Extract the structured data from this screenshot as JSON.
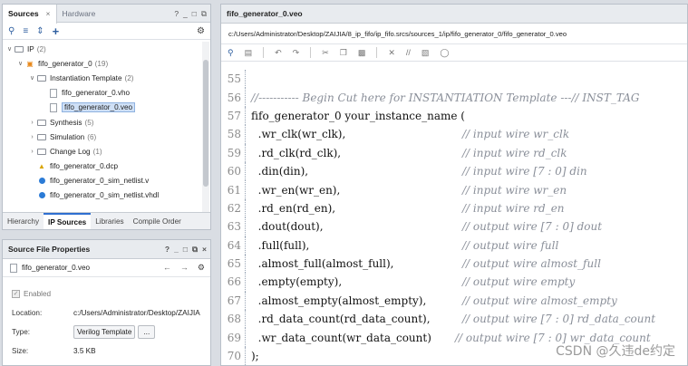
{
  "sources_panel": {
    "tabs": [
      "Sources",
      "Hardware"
    ],
    "tab_close": "×",
    "window_controls": [
      "?",
      "_",
      "□",
      "⧉"
    ],
    "toolbar_icons": [
      "search-icon",
      "collapse-all-icon",
      "expand-all-icon",
      "add-icon",
      "gear-icon"
    ],
    "tree": [
      {
        "label": "IP",
        "count": "(2)"
      },
      {
        "label": "fifo_generator_0",
        "count": "(19)"
      },
      {
        "label": "Instantiation Template",
        "count": "(2)"
      },
      {
        "label": "fifo_generator_0.vho",
        "count": ""
      },
      {
        "label": "fifo_generator_0.veo",
        "count": ""
      },
      {
        "label": "Synthesis",
        "count": "(5)"
      },
      {
        "label": "Simulation",
        "count": "(6)"
      },
      {
        "label": "Change Log",
        "count": "(1)"
      },
      {
        "label": "fifo_generator_0.dcp",
        "count": ""
      },
      {
        "label": "fifo_generator_0_sim_netlist.v",
        "count": ""
      },
      {
        "label": "fifo_generator_0_sim_netlist.vhdl",
        "count": ""
      }
    ],
    "bottom_tabs": [
      "Hierarchy",
      "IP Sources",
      "Libraries",
      "Compile Order"
    ]
  },
  "properties_panel": {
    "title": "Source File Properties",
    "window_controls": [
      "?",
      "_",
      "□",
      "⧉",
      "×"
    ],
    "file": "fifo_generator_0.veo",
    "enabled_label": "Enabled",
    "location_label": "Location:",
    "location_value": "c:/Users/Administrator/Desktop/ZAIJIA",
    "type_label": "Type:",
    "type_value": "Verilog Template",
    "type_button": "...",
    "size_label": "Size:",
    "size_value": "3.5 KB"
  },
  "editor": {
    "tab_title": "fifo_generator_0.veo",
    "path": "c:/Users/Administrator/Desktop/ZAIJIA/8_ip_fifo/ip_fifo.srcs/sources_1/ip/fifo_generator_0/fifo_generator_0.veo",
    "lines": [
      {
        "n": "55",
        "code": "",
        "comment": ""
      },
      {
        "n": "56",
        "code": "",
        "comment": "//----------- Begin Cut here for INSTANTIATION Template ---// INST_TAG"
      },
      {
        "n": "57",
        "code": "fifo_generator_0 your_instance_name (",
        "comment": ""
      },
      {
        "n": "58",
        "code": "  .wr_clk(wr_clk),",
        "comment": "// input wire wr_clk"
      },
      {
        "n": "59",
        "code": "  .rd_clk(rd_clk),",
        "comment": "// input wire rd_clk"
      },
      {
        "n": "60",
        "code": "  .din(din),",
        "comment": "// input wire [7 : 0] din"
      },
      {
        "n": "61",
        "code": "  .wr_en(wr_en),",
        "comment": "// input wire wr_en"
      },
      {
        "n": "62",
        "code": "  .rd_en(rd_en),",
        "comment": "// input wire rd_en"
      },
      {
        "n": "63",
        "code": "  .dout(dout),",
        "comment": "// output wire [7 : 0] dout"
      },
      {
        "n": "64",
        "code": "  .full(full),",
        "comment": "// output wire full"
      },
      {
        "n": "65",
        "code": "  .almost_full(almost_full),",
        "comment": "// output wire almost_full"
      },
      {
        "n": "66",
        "code": "  .empty(empty),",
        "comment": "// output wire empty"
      },
      {
        "n": "67",
        "code": "  .almost_empty(almost_empty),",
        "comment": "// output wire almost_empty"
      },
      {
        "n": "68",
        "code": "  .rd_data_count(rd_data_count),",
        "comment": "// output wire [7 : 0] rd_data_count"
      },
      {
        "n": "69",
        "code": "  .wr_data_count(wr_data_count)",
        "comment": "// output wire [7 : 0] wr_data_count"
      },
      {
        "n": "70",
        "code": ");",
        "comment": ""
      }
    ]
  },
  "watermark": "CSDN @久违de约定"
}
